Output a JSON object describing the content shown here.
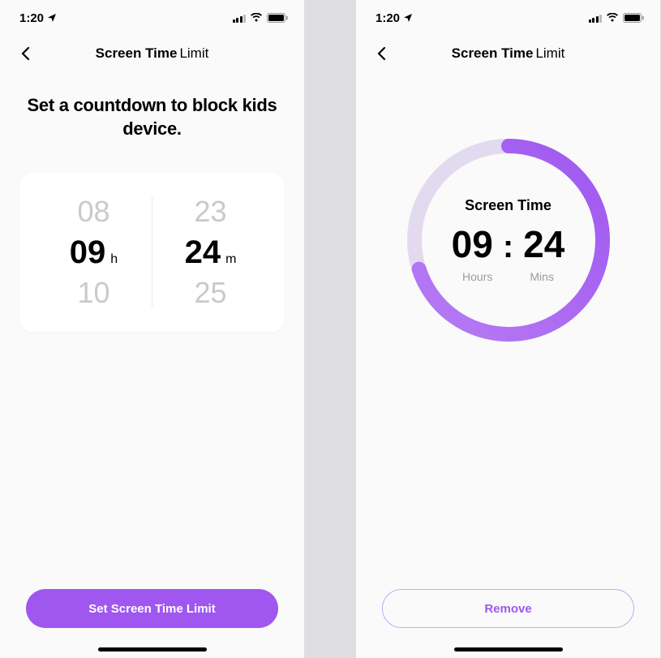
{
  "status": {
    "time": "1:20"
  },
  "nav": {
    "title_bold": "Screen Time",
    "title_reg": "Limit"
  },
  "left_screen": {
    "heading": "Set a countdown to block kids device.",
    "picker": {
      "hours_above": "08",
      "hours_selected": "09",
      "hours_below": "10",
      "hours_unit": "h",
      "mins_above": "23",
      "mins_selected": "24",
      "mins_below": "25",
      "mins_unit": "m"
    },
    "button_label": "Set Screen Time Limit"
  },
  "right_screen": {
    "circle": {
      "title": "Screen Time",
      "hours": "09",
      "mins": "24",
      "hours_label": "Hours",
      "mins_label": "Mins",
      "progress_fraction": 0.7
    },
    "button_label": "Remove"
  },
  "colors": {
    "accent": "#9f57f0",
    "accent_light": "#c8a9ee",
    "track": "#dcd2e8"
  }
}
